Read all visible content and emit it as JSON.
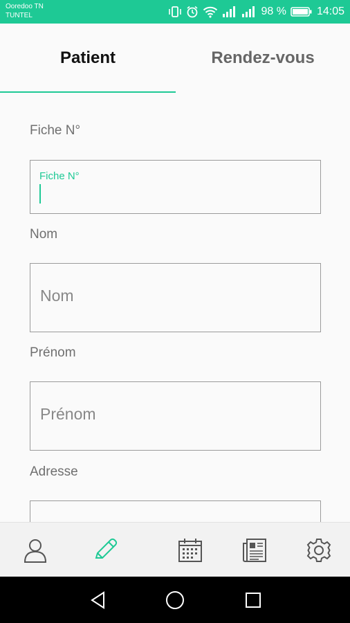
{
  "status_bar": {
    "carrier_line1": "Ooredoo TN",
    "carrier_line2": "TUNTEL",
    "battery_text": "98 %",
    "time": "14:05"
  },
  "tabs": [
    {
      "label": "Patient",
      "active": true
    },
    {
      "label": "Rendez-vous",
      "active": false
    }
  ],
  "form": {
    "fiche": {
      "label": "Fiche N°",
      "floating_label": "Fiche N°",
      "value": ""
    },
    "nom": {
      "label": "Nom",
      "placeholder": "Nom",
      "value": ""
    },
    "prenom": {
      "label": "Prénom",
      "placeholder": "Prénom",
      "value": ""
    },
    "adresse": {
      "label": "Adresse",
      "value": ""
    }
  },
  "bottom_nav": {
    "items": [
      {
        "icon": "user-icon"
      },
      {
        "icon": "pencil-icon",
        "active": true
      },
      {
        "icon": "calendar-icon"
      },
      {
        "icon": "newspaper-icon"
      },
      {
        "icon": "gear-icon"
      }
    ]
  },
  "colors": {
    "accent": "#1ec995",
    "icon": "#555555"
  }
}
